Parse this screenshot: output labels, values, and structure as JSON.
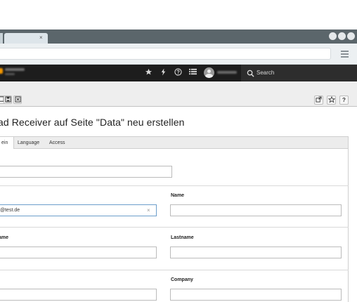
{
  "browser": {
    "tab_close": "×"
  },
  "topbar": {
    "icons": [
      "star-icon",
      "flash-icon",
      "help-icon",
      "list-icon",
      "user-avatar"
    ],
    "search_label": "Search"
  },
  "docheader": {
    "left_buttons": [
      "record-icon",
      "save-icon",
      "save-close-icon"
    ],
    "right_buttons": [
      "open-new-window-icon",
      "bookmark-star-icon",
      "help-icon"
    ],
    "help_label": "?"
  },
  "page": {
    "title": "nload Receiver auf Seite \"Data\" neu erstellen"
  },
  "tabs": [
    {
      "label": "ein",
      "active": true
    },
    {
      "label": "Language",
      "active": false
    },
    {
      "label": "Access",
      "active": false
    }
  ],
  "form": {
    "email_value": "@test.de",
    "clear_icon": "×",
    "labels": {
      "name": "Name",
      "firstname_partial": "ame",
      "lastname": "Lastname",
      "company": "Company"
    }
  }
}
